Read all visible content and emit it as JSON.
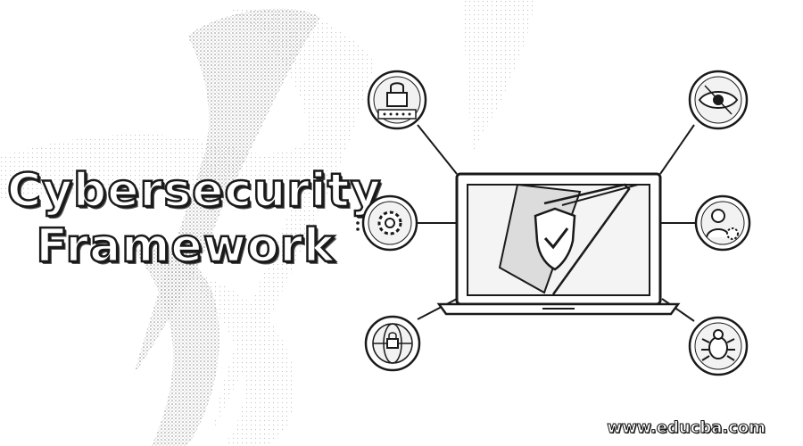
{
  "title": {
    "line1": "Cybersecurity",
    "line2": "Framework"
  },
  "watermark": "www.educba.com",
  "icons": [
    "lock-password-icon",
    "eye-icon",
    "gear-icon",
    "user-gear-icon",
    "globe-lock-icon",
    "bug-icon",
    "shield-check-icon",
    "laptop-icon"
  ],
  "colors": {
    "ink": "#1a1a1a",
    "background": "#ffffff"
  }
}
